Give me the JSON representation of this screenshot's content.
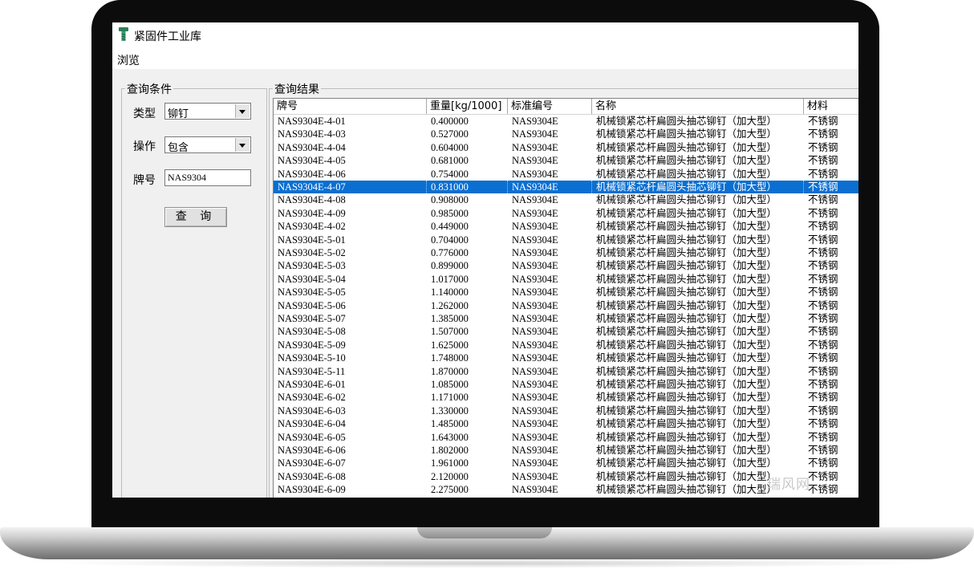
{
  "window": {
    "title": "紧固件工业库"
  },
  "menu": {
    "browse": "浏览"
  },
  "query_panel": {
    "legend": "查询条件",
    "type_label": "类型",
    "type_value": "铆钉",
    "operation_label": "操作",
    "operation_value": "包含",
    "brand_label": "牌号",
    "brand_value": "NAS9304",
    "query_button": "查 询"
  },
  "results": {
    "legend": "查询结果",
    "columns": [
      "牌号",
      "重量[kg/1000]",
      "标准编号",
      "名称",
      "材料"
    ],
    "selected_index": 5,
    "rows": [
      [
        "NAS9304E-4-01",
        "0.400000",
        "NAS9304E",
        "机械锁紧芯杆扁圆头抽芯铆钉（加大型）",
        "不锈钢"
      ],
      [
        "NAS9304E-4-03",
        "0.527000",
        "NAS9304E",
        "机械锁紧芯杆扁圆头抽芯铆钉（加大型）",
        "不锈钢"
      ],
      [
        "NAS9304E-4-04",
        "0.604000",
        "NAS9304E",
        "机械锁紧芯杆扁圆头抽芯铆钉（加大型）",
        "不锈钢"
      ],
      [
        "NAS9304E-4-05",
        "0.681000",
        "NAS9304E",
        "机械锁紧芯杆扁圆头抽芯铆钉（加大型）",
        "不锈钢"
      ],
      [
        "NAS9304E-4-06",
        "0.754000",
        "NAS9304E",
        "机械锁紧芯杆扁圆头抽芯铆钉（加大型）",
        "不锈钢"
      ],
      [
        "NAS9304E-4-07",
        "0.831000",
        "NAS9304E",
        "机械锁紧芯杆扁圆头抽芯铆钉（加大型）",
        "不锈钢"
      ],
      [
        "NAS9304E-4-08",
        "0.908000",
        "NAS9304E",
        "机械锁紧芯杆扁圆头抽芯铆钉（加大型）",
        "不锈钢"
      ],
      [
        "NAS9304E-4-09",
        "0.985000",
        "NAS9304E",
        "机械锁紧芯杆扁圆头抽芯铆钉（加大型）",
        "不锈钢"
      ],
      [
        "NAS9304E-4-02",
        "0.449000",
        "NAS9304E",
        "机械锁紧芯杆扁圆头抽芯铆钉（加大型）",
        "不锈钢"
      ],
      [
        "NAS9304E-5-01",
        "0.704000",
        "NAS9304E",
        "机械锁紧芯杆扁圆头抽芯铆钉（加大型）",
        "不锈钢"
      ],
      [
        "NAS9304E-5-02",
        "0.776000",
        "NAS9304E",
        "机械锁紧芯杆扁圆头抽芯铆钉（加大型）",
        "不锈钢"
      ],
      [
        "NAS9304E-5-03",
        "0.899000",
        "NAS9304E",
        "机械锁紧芯杆扁圆头抽芯铆钉（加大型）",
        "不锈钢"
      ],
      [
        "NAS9304E-5-04",
        "1.017000",
        "NAS9304E",
        "机械锁紧芯杆扁圆头抽芯铆钉（加大型）",
        "不锈钢"
      ],
      [
        "NAS9304E-5-05",
        "1.140000",
        "NAS9304E",
        "机械锁紧芯杆扁圆头抽芯铆钉（加大型）",
        "不锈钢"
      ],
      [
        "NAS9304E-5-06",
        "1.262000",
        "NAS9304E",
        "机械锁紧芯杆扁圆头抽芯铆钉（加大型）",
        "不锈钢"
      ],
      [
        "NAS9304E-5-07",
        "1.385000",
        "NAS9304E",
        "机械锁紧芯杆扁圆头抽芯铆钉（加大型）",
        "不锈钢"
      ],
      [
        "NAS9304E-5-08",
        "1.507000",
        "NAS9304E",
        "机械锁紧芯杆扁圆头抽芯铆钉（加大型）",
        "不锈钢"
      ],
      [
        "NAS9304E-5-09",
        "1.625000",
        "NAS9304E",
        "机械锁紧芯杆扁圆头抽芯铆钉（加大型）",
        "不锈钢"
      ],
      [
        "NAS9304E-5-10",
        "1.748000",
        "NAS9304E",
        "机械锁紧芯杆扁圆头抽芯铆钉（加大型）",
        "不锈钢"
      ],
      [
        "NAS9304E-5-11",
        "1.870000",
        "NAS9304E",
        "机械锁紧芯杆扁圆头抽芯铆钉（加大型）",
        "不锈钢"
      ],
      [
        "NAS9304E-6-01",
        "1.085000",
        "NAS9304E",
        "机械锁紧芯杆扁圆头抽芯铆钉（加大型）",
        "不锈钢"
      ],
      [
        "NAS9304E-6-02",
        "1.171000",
        "NAS9304E",
        "机械锁紧芯杆扁圆头抽芯铆钉（加大型）",
        "不锈钢"
      ],
      [
        "NAS9304E-6-03",
        "1.330000",
        "NAS9304E",
        "机械锁紧芯杆扁圆头抽芯铆钉（加大型）",
        "不锈钢"
      ],
      [
        "NAS9304E-6-04",
        "1.485000",
        "NAS9304E",
        "机械锁紧芯杆扁圆头抽芯铆钉（加大型）",
        "不锈钢"
      ],
      [
        "NAS9304E-6-05",
        "1.643000",
        "NAS9304E",
        "机械锁紧芯杆扁圆头抽芯铆钉（加大型）",
        "不锈钢"
      ],
      [
        "NAS9304E-6-06",
        "1.802000",
        "NAS9304E",
        "机械锁紧芯杆扁圆头抽芯铆钉（加大型）",
        "不锈钢"
      ],
      [
        "NAS9304E-6-07",
        "1.961000",
        "NAS9304E",
        "机械锁紧芯杆扁圆头抽芯铆钉（加大型）",
        "不锈钢"
      ],
      [
        "NAS9304E-6-08",
        "2.120000",
        "NAS9304E",
        "机械锁紧芯杆扁圆头抽芯铆钉（加大型）",
        "不锈钢"
      ],
      [
        "NAS9304E-6-09",
        "2.275000",
        "NAS9304E",
        "机械锁紧芯杆扁圆头抽芯铆钉（加大型）",
        "不锈钢"
      ]
    ]
  },
  "watermark": "瑞风网",
  "colors": {
    "selection": "#0a6fd1",
    "window_bg": "#f0f0f0"
  },
  "icons": {
    "app_icon": "screw-icon",
    "dropdown": "chevron-down-icon"
  }
}
